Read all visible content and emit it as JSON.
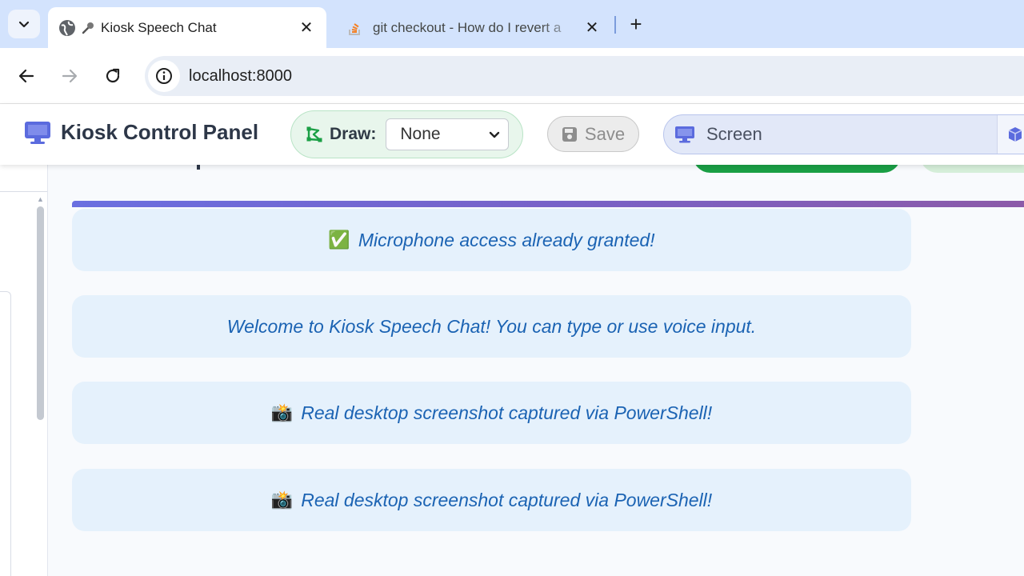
{
  "browser": {
    "tabs": [
      {
        "title": "Kiosk Speech Chat",
        "active": true
      },
      {
        "title": "git checkout - How do I revert a",
        "active": false
      }
    ],
    "url": "localhost:8000"
  },
  "header": {
    "brand_title": "Kiosk Control Panel",
    "draw_label": "Draw:",
    "draw_value": "None",
    "save_label": "Save",
    "screen_label": "Screen"
  },
  "messages": [
    {
      "emoji": "✅",
      "text": "Microphone access already granted!"
    },
    {
      "emoji": "",
      "text": "Welcome to Kiosk Speech Chat! You can type or use voice input."
    },
    {
      "emoji": "📸",
      "text": "Real desktop screenshot captured via PowerShell!"
    },
    {
      "emoji": "📸",
      "text": "Real desktop screenshot captured via PowerShell!"
    }
  ],
  "colors": {
    "accent": "#5b6bde",
    "message_text": "#1b63b3",
    "message_bg": "#e5f1fc",
    "draw_bg": "#e8f6ec",
    "green": "#1a9f45"
  },
  "icons": {
    "tab_search": "chevron-down-icon",
    "tab_favicon": "globe-icon",
    "tab_title_icon": "microphone-icon",
    "inactive_favicon": "stackoverflow-icon",
    "back": "arrow-left-icon",
    "forward": "arrow-right-icon",
    "reload": "reload-icon",
    "site_info": "info-icon",
    "brand": "desktop-icon",
    "draw": "draw-polygon-icon",
    "save": "floppy-disk-icon",
    "screen": "desktop-icon",
    "screen_ext": "cube-icon"
  }
}
